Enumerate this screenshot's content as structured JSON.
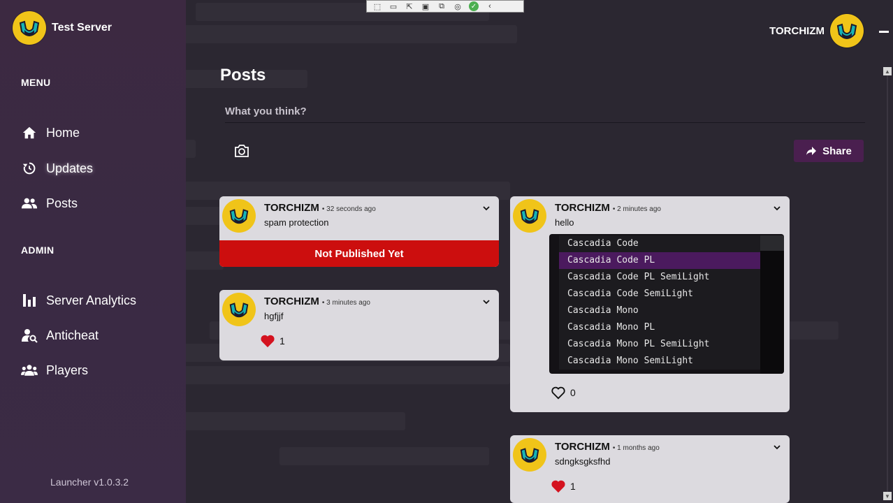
{
  "app": {
    "server_name": "Test Server",
    "version": "Launcher v1.0.3.2"
  },
  "user": {
    "name": "TORCHIZM"
  },
  "sidebar": {
    "menu_label": "MENU",
    "admin_label": "ADMIN",
    "menu_items": [
      {
        "label": "Home",
        "icon": "home-icon"
      },
      {
        "label": "Updates",
        "icon": "updates-icon"
      },
      {
        "label": "Posts",
        "icon": "users-icon"
      }
    ],
    "admin_items": [
      {
        "label": "Server Analytics",
        "icon": "bar-chart-icon"
      },
      {
        "label": "Anticheat",
        "icon": "user-search-icon"
      },
      {
        "label": "Players",
        "icon": "players-icon"
      }
    ]
  },
  "main": {
    "title": "Posts",
    "composer_placeholder": "What you think?",
    "share_label": "Share"
  },
  "posts": [
    {
      "author": "TORCHIZM",
      "time": "• 32 seconds ago",
      "text": "spam protection",
      "status": "Not Published Yet"
    },
    {
      "author": "TORCHIZM",
      "time": "• 3 minutes ago",
      "text": "hgfjjf",
      "likes": "1",
      "liked": true
    },
    {
      "author": "TORCHIZM",
      "time": "• 2 minutes ago",
      "text": "hello",
      "likes": "0",
      "liked": false,
      "image_list": [
        "Cascadia Code",
        "Cascadia Code PL",
        "Cascadia Code PL SemiLight",
        "Cascadia Code SemiLight",
        "Cascadia Mono",
        "Cascadia Mono PL",
        "Cascadia Mono PL SemiLight",
        "Cascadia Mono SemiLight"
      ],
      "image_selected": "Cascadia Code PL"
    },
    {
      "author": "TORCHIZM",
      "time": "• 1 months ago",
      "text": "sdngksgksfhd",
      "likes": "1",
      "liked": true
    }
  ],
  "colors": {
    "accent": "#4a1f4f",
    "sidebar": "#3c2941",
    "background": "#2b2731",
    "card": "#dcdadf",
    "unpublished": "#cc0e0e",
    "like": "#d4121f",
    "logo": "#f0c419"
  }
}
